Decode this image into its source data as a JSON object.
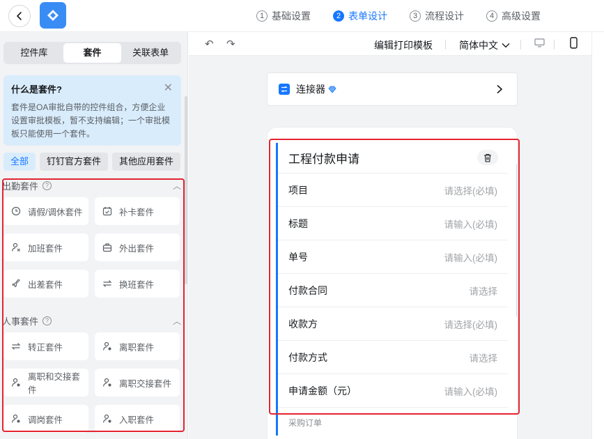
{
  "header": {
    "steps": [
      {
        "num": "1",
        "label": "基础设置"
      },
      {
        "num": "2",
        "label": "表单设计"
      },
      {
        "num": "3",
        "label": "流程设计"
      },
      {
        "num": "4",
        "label": "高级设置"
      }
    ],
    "active_step": 2
  },
  "left": {
    "tabs": [
      "控件库",
      "套件",
      "关联表单"
    ],
    "active_tab": "套件",
    "info": {
      "title": "什么是套件?",
      "text": "套件是OA审批自带的控件组合，方便企业设置审批模板，暂不支持编辑；一个审批模板只能使用一个套件。"
    },
    "filters": [
      "全部",
      "钉钉官方套件",
      "其他应用套件"
    ],
    "sections": [
      {
        "title": "出勤套件",
        "items": [
          {
            "label": "请假/调休套件",
            "icon": "clock-icon"
          },
          {
            "label": "补卡套件",
            "icon": "calendar-check-icon"
          },
          {
            "label": "加班套件",
            "icon": "overtime-icon"
          },
          {
            "label": "外出套件",
            "icon": "briefcase-icon"
          },
          {
            "label": "出差套件",
            "icon": "plane-icon"
          },
          {
            "label": "换班套件",
            "icon": "swap-icon"
          }
        ]
      },
      {
        "title": "人事套件",
        "items": [
          {
            "label": "转正套件",
            "icon": "swap-icon"
          },
          {
            "label": "离职套件",
            "icon": "person-leave-icon"
          },
          {
            "label": "离职和交接套件",
            "icon": "person-leave-icon"
          },
          {
            "label": "离职交接套件",
            "icon": "person-leave-icon"
          },
          {
            "label": "调岗套件",
            "icon": "person-leave-icon"
          },
          {
            "label": "入职套件",
            "icon": "person-leave-icon"
          }
        ]
      }
    ]
  },
  "toolbar": {
    "print_template": "编辑打印模板",
    "language": "简体中文"
  },
  "connector": {
    "label": "连接器"
  },
  "form": {
    "title": "工程付款申请",
    "rows": [
      {
        "label": "项目",
        "placeholder": "请选择(必填)"
      },
      {
        "label": "标题",
        "placeholder": "请输入(必填)"
      },
      {
        "label": "单号",
        "placeholder": "请输入(必填)"
      },
      {
        "label": "付款合同",
        "placeholder": "请选择"
      },
      {
        "label": "收款方",
        "placeholder": "请选择(必填)"
      },
      {
        "label": "付款方式",
        "placeholder": "请选择"
      },
      {
        "label": "申请金额（元）",
        "placeholder": "请输入(必填)"
      }
    ],
    "next_label": "采购订单"
  },
  "colors": {
    "accent": "#1677ff",
    "highlight": "#e4232f",
    "info_bg": "#d9ecfc"
  }
}
